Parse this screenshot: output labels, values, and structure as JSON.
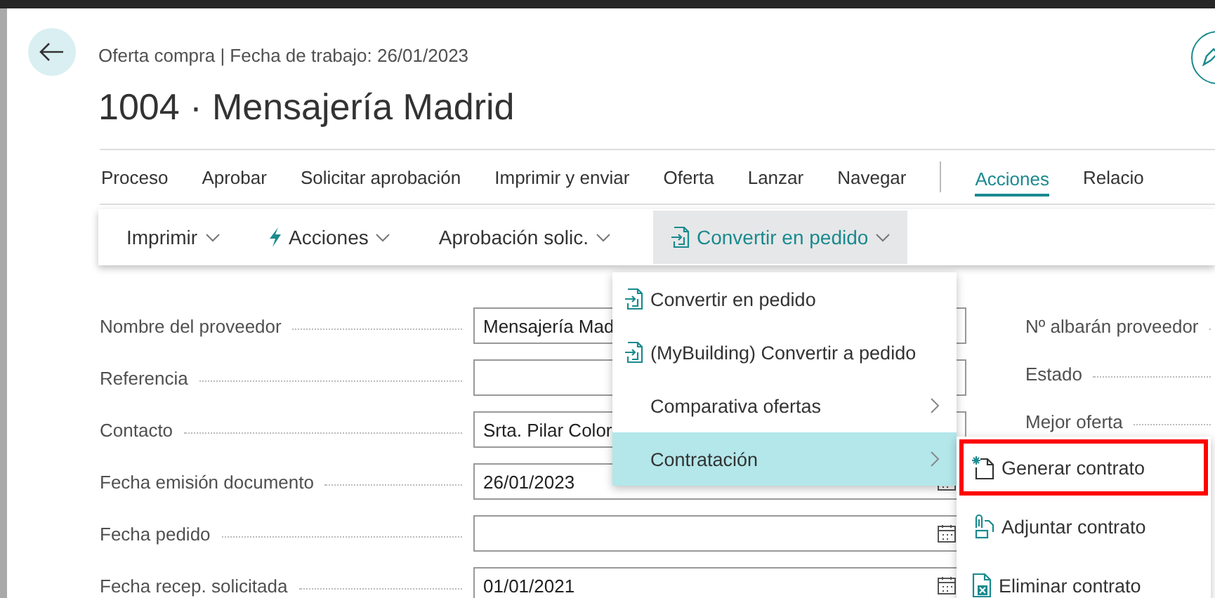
{
  "header": {
    "breadcrumb": "Oferta compra | Fecha de trabajo: 26/01/2023",
    "title": "1004 · Mensajería Madrid"
  },
  "action_tabs": [
    {
      "label": "Proceso",
      "selected": false
    },
    {
      "label": "Aprobar",
      "selected": false
    },
    {
      "label": "Solicitar aprobación",
      "selected": false
    },
    {
      "label": "Imprimir y enviar",
      "selected": false
    },
    {
      "label": "Oferta",
      "selected": false
    },
    {
      "label": "Lanzar",
      "selected": false
    },
    {
      "label": "Navegar",
      "selected": false,
      "separator_after": true
    },
    {
      "label": "Acciones",
      "selected": true
    },
    {
      "label": "Relacio",
      "selected": false
    }
  ],
  "toolbar": [
    {
      "label": "Imprimir",
      "kind": "plain",
      "selected": false
    },
    {
      "label": "Acciones",
      "kind": "bolt",
      "selected": false
    },
    {
      "label": "Aprobación solic.",
      "kind": "plain",
      "selected": false
    },
    {
      "label": "Convertir en pedido",
      "kind": "convert",
      "selected": true
    }
  ],
  "fields": [
    {
      "label": "Nombre del proveedor",
      "value": "Mensajería Mad",
      "kind": "lookup"
    },
    {
      "label": "Referencia",
      "kind": "text"
    },
    {
      "label": "Contacto",
      "value": "Srta. Pilar Color",
      "kind": "text"
    },
    {
      "label": "Fecha emisión documento",
      "value": "26/01/2023",
      "kind": "date"
    },
    {
      "label": "Fecha pedido",
      "kind": "date"
    },
    {
      "label": "Fecha recep. solicitada",
      "value": "01/01/2021",
      "kind": "date"
    }
  ],
  "right_fields": [
    {
      "label": "Nº albarán proveedor"
    },
    {
      "label": "Estado"
    },
    {
      "label": "Mejor oferta"
    }
  ],
  "menu": [
    {
      "label": "Convertir en pedido",
      "kind": "convert",
      "submenu": false,
      "selected": false
    },
    {
      "label": "(MyBuilding) Convertir a pedido",
      "kind": "convert",
      "submenu": false,
      "selected": false
    },
    {
      "label": "Comparativa ofertas",
      "kind": "plain",
      "submenu": true,
      "selected": false
    },
    {
      "label": "Contratación",
      "kind": "plain",
      "submenu": true,
      "selected": true
    }
  ],
  "submenu": [
    {
      "label": "Generar contrato",
      "kind": "new",
      "highlighted": true
    },
    {
      "label": "Adjuntar contrato",
      "kind": "attach",
      "highlighted": false
    },
    {
      "label": "Eliminar contrato",
      "kind": "delete",
      "highlighted": false
    }
  ]
}
